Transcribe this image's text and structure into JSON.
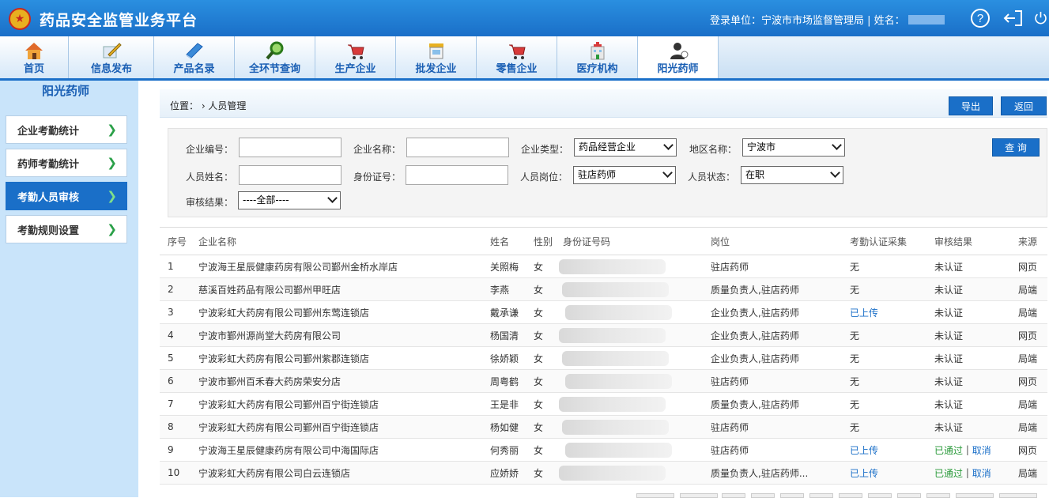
{
  "header": {
    "title": "药品安全监管业务平台",
    "login_label": "登录单位：",
    "login_unit": "宁波市市场监督管理局",
    "name_label": "| 姓名："
  },
  "nav": {
    "items": [
      {
        "label": "首页",
        "icon": "home-icon"
      },
      {
        "label": "信息发布",
        "icon": "edit-icon"
      },
      {
        "label": "产品名录",
        "icon": "book-icon"
      },
      {
        "label": "全环节查询",
        "icon": "search-icon"
      },
      {
        "label": "生产企业",
        "icon": "cart-icon"
      },
      {
        "label": "批发企业",
        "icon": "store-icon"
      },
      {
        "label": "零售企业",
        "icon": "cart-icon"
      },
      {
        "label": "医疗机构",
        "icon": "hospital-icon"
      },
      {
        "label": "阳光药师",
        "icon": "pharmacist-icon"
      }
    ],
    "active": "阳光药师"
  },
  "sidebar": {
    "title": "阳光药师",
    "items": [
      {
        "label": "企业考勤统计"
      },
      {
        "label": "药师考勤统计"
      },
      {
        "label": "考勤人员审核"
      },
      {
        "label": "考勤规则设置"
      }
    ],
    "active": "考勤人员审核"
  },
  "breadcrumb": {
    "text": "位置： › 人员管理"
  },
  "toolbar": {
    "export_label": "导出",
    "back_label": "返回",
    "search_label": "查 询"
  },
  "filters": {
    "company_code_label": "企业编号：",
    "company_name_label": "企业名称：",
    "company_type_label": "企业类型：",
    "company_type_value": "药品经营企业",
    "region_label": "地区名称：",
    "region_value": "宁波市",
    "person_name_label": "人员姓名：",
    "id_label": "身份证号：",
    "post_label": "人员岗位：",
    "post_value": "驻店药师",
    "status_label": "人员状态：",
    "status_value": "在职",
    "audit_label": "审核结果：",
    "audit_value": "----全部----"
  },
  "table": {
    "headers": [
      "序号",
      "企业名称",
      "姓名",
      "性别",
      "身份证号码",
      "岗位",
      "考勤认证采集",
      "审核结果",
      "来源"
    ],
    "rows": [
      {
        "no": "1",
        "company": "宁波海王星辰健康药房有限公司鄞州金桥水岸店",
        "name": "关照梅",
        "gender": "女",
        "post": "驻店药师",
        "collect": "无",
        "audit": "未认证",
        "cancel": "",
        "source": "网页"
      },
      {
        "no": "2",
        "company": "慈溪百姓药品有限公司鄞州甲旺店",
        "name": "李燕",
        "gender": "女",
        "post": "质量负责人,驻店药师",
        "collect": "无",
        "audit": "未认证",
        "cancel": "",
        "source": "局端"
      },
      {
        "no": "3",
        "company": "宁波彩虹大药房有限公司鄞州东莺连锁店",
        "name": "戴承谦",
        "gender": "女",
        "post": "企业负责人,驻店药师",
        "collect": "已上传",
        "audit": "未认证",
        "cancel": "",
        "source": "局端"
      },
      {
        "no": "4",
        "company": "宁波市鄞州源尚堂大药房有限公司",
        "name": "杨国清",
        "gender": "女",
        "post": "企业负责人,驻店药师",
        "collect": "无",
        "audit": "未认证",
        "cancel": "",
        "source": "网页"
      },
      {
        "no": "5",
        "company": "宁波彩虹大药房有限公司鄞州紫郡连锁店",
        "name": "徐娇颖",
        "gender": "女",
        "post": "企业负责人,驻店药师",
        "collect": "无",
        "audit": "未认证",
        "cancel": "",
        "source": "局端"
      },
      {
        "no": "6",
        "company": "宁波市鄞州百禾春大药房荣安分店",
        "name": "周粤鹤",
        "gender": "女",
        "post": "驻店药师",
        "collect": "无",
        "audit": "未认证",
        "cancel": "",
        "source": "网页"
      },
      {
        "no": "7",
        "company": "宁波彩虹大药房有限公司鄞州百宁街连锁店",
        "name": "王是非",
        "gender": "女",
        "post": "质量负责人,驻店药师",
        "collect": "无",
        "audit": "未认证",
        "cancel": "",
        "source": "局端"
      },
      {
        "no": "8",
        "company": "宁波彩虹大药房有限公司鄞州百宁街连锁店",
        "name": "杨如健",
        "gender": "女",
        "post": "驻店药师",
        "collect": "无",
        "audit": "未认证",
        "cancel": "",
        "source": "局端"
      },
      {
        "no": "9",
        "company": "宁波海王星辰健康药房有限公司中海国际店",
        "name": "何秀丽",
        "gender": "女",
        "post": "驻店药师",
        "collect": "已上传",
        "audit": "已通过",
        "cancel": "取消",
        "source": "网页"
      },
      {
        "no": "10",
        "company": "宁波彩虹大药房有限公司白云连锁店",
        "name": "应娇娇",
        "gender": "女",
        "post": "质量负责人,驻店药师...",
        "collect": "已上传",
        "audit": "已通过",
        "cancel": "取消",
        "source": "局端"
      }
    ]
  },
  "colors": {
    "header_blue": "#1a6fc8",
    "sidebar_bg": "#c9e4fa",
    "link_blue": "#1a6fc8",
    "pass_green": "#2a9a3a"
  }
}
